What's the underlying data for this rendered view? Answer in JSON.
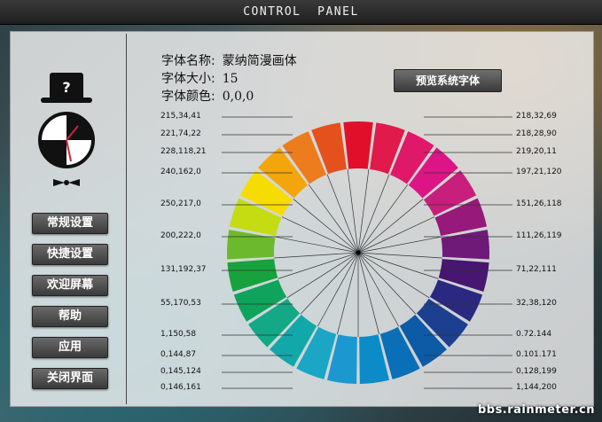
{
  "window": {
    "title": "CONTROL  PANEL"
  },
  "sidebar": {
    "items": [
      {
        "label": "常规设置"
      },
      {
        "label": "快捷设置"
      },
      {
        "label": "欢迎屏幕"
      },
      {
        "label": "帮助"
      },
      {
        "label": "应用"
      },
      {
        "label": "关闭界面"
      }
    ]
  },
  "font_info": {
    "name_label": "字体名称:",
    "name_value": "蒙纳简漫画体",
    "size_label": "字体大小:",
    "size_value": "15",
    "color_label": "字体颜色:",
    "color_value": "0,0,0"
  },
  "preview_button": {
    "label": "预览系统字体"
  },
  "color_wheel": {
    "left_labels": [
      "215,34,41",
      "221,74,22",
      "228,118,21",
      "240,162,0",
      "250,217,0",
      "200,222,0",
      "131,192,37",
      "55,170,53",
      "1,150,58",
      "0,144,87",
      "0,145,124",
      "0,146,161"
    ],
    "right_labels": [
      "218,32,69",
      "218,28,90",
      "219,20,11",
      "197,21,120",
      "151,26,118",
      "111,26,119",
      "71,22,111",
      "32,38,120",
      "0.72.144",
      "0.101.171",
      "0,128,199",
      "1,144,200"
    ],
    "segments": [
      "#e20f2b",
      "#e01a4a",
      "#e0186a",
      "#dd1486",
      "#c81f7c",
      "#97197a",
      "#6f1a78",
      "#471670",
      "#2a2880",
      "#1d3f8f",
      "#0d5aa6",
      "#0a6fb7",
      "#0b8cc8",
      "#1b98cf",
      "#1aa6c4",
      "#12a8aa",
      "#14a886",
      "#0fa35c",
      "#18a23d",
      "#6cb92e",
      "#c5db12",
      "#f7dc00",
      "#f3a60c",
      "#ec7c1e",
      "#e4511d"
    ]
  },
  "watermark": "bbs.rainmeter.cn"
}
